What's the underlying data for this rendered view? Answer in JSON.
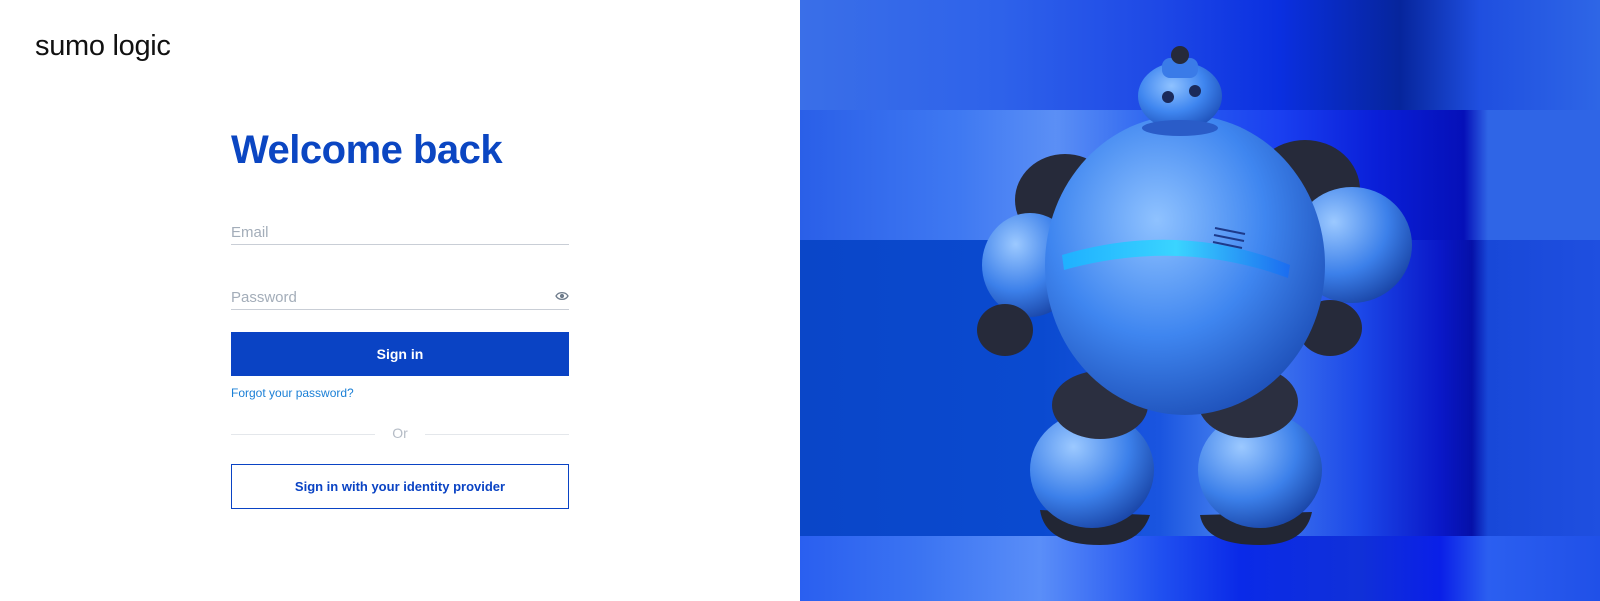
{
  "brand": {
    "logo_text": "sumo logic"
  },
  "login": {
    "title": "Welcome back",
    "email_placeholder": "Email",
    "email_value": "",
    "password_placeholder": "Password",
    "password_value": "",
    "show_password_icon": "eye-icon",
    "sign_in_label": "Sign in",
    "forgot_label": "Forgot your password?",
    "divider_label": "Or",
    "idp_label": "Sign in with your identity provider"
  },
  "hero": {
    "illustration": "robot-mascot"
  },
  "colors": {
    "title": "#0b46c2",
    "primary_button": "#0a43c4",
    "link": "#1a7fd6",
    "hero_background": "#1f4fe0"
  }
}
